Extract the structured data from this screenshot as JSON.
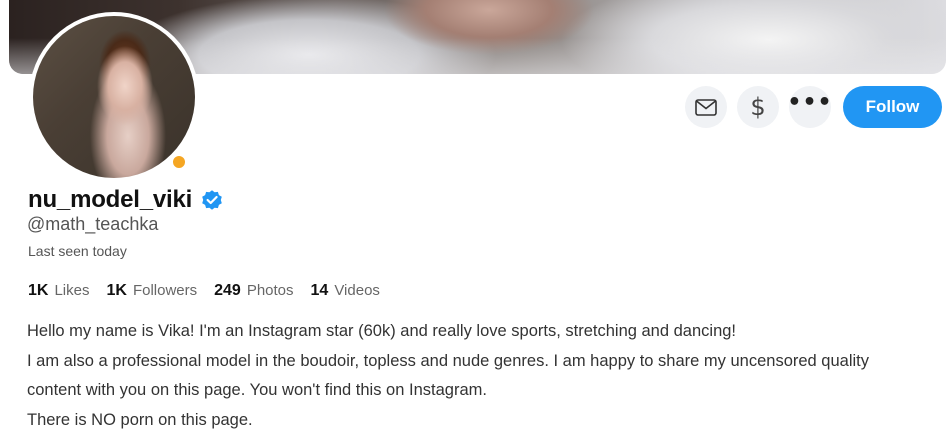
{
  "profile": {
    "username": "nu_model_viki",
    "handle": "@math_teachka",
    "last_seen": "Last seen today",
    "online_status_color": "#f5a623",
    "verified": true
  },
  "actions": {
    "message_icon": "envelope-icon",
    "tip_icon": "dollar-icon",
    "more_icon": "more-dots-icon",
    "tip_symbol": "$",
    "more_symbol": "•••",
    "follow_label": "Follow",
    "accent_color": "#2196f3"
  },
  "stats": [
    {
      "value": "1K",
      "label": "Likes"
    },
    {
      "value": "1K",
      "label": "Followers"
    },
    {
      "value": "249",
      "label": "Photos"
    },
    {
      "value": "14",
      "label": "Videos"
    }
  ],
  "bio": [
    "Hello my name is Vika! I'm an Instagram star (60k) and really love sports, stretching and dancing!",
    "I am also a professional model in the boudoir, topless and nude genres. I am happy to share my uncensored quality",
    "content with you on this page. You won't find this on Instagram.",
    "There is NO porn on this page."
  ]
}
